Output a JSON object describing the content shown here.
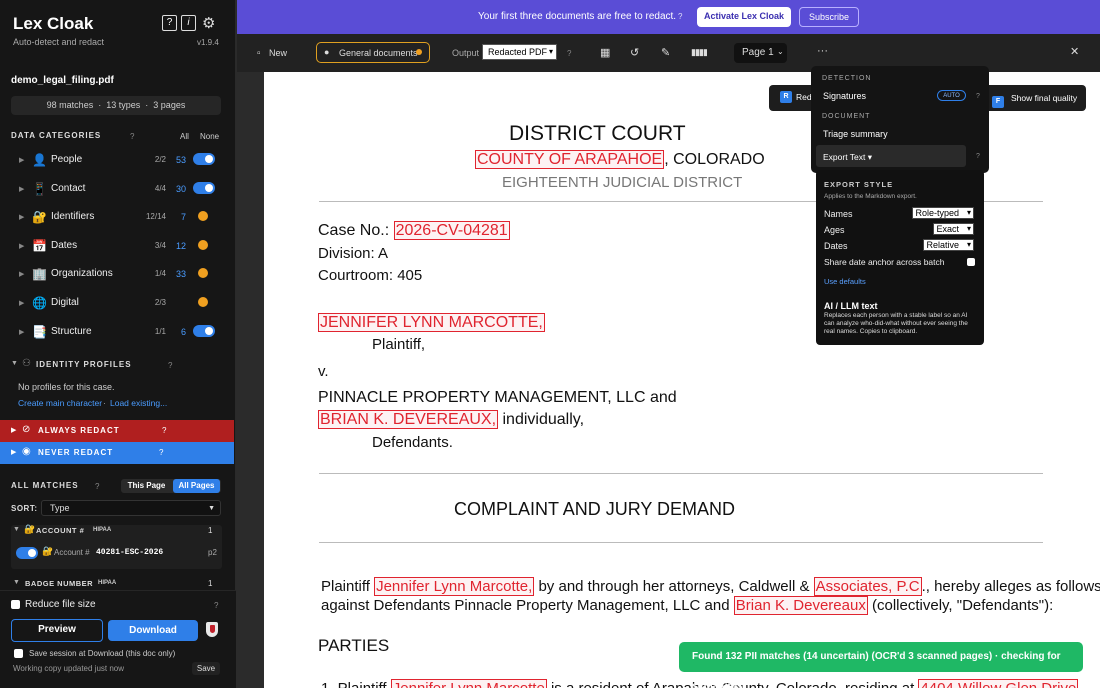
{
  "app": {
    "name": "Lex Cloak",
    "tagline": "Auto-detect and redact",
    "version": "v1.9.4",
    "help": "?",
    "info": "i",
    "settings_icon": "gear-icon"
  },
  "file": {
    "name": "demo_legal_filing.pdf",
    "matches": "98 matches",
    "types": "13 types",
    "pages": "3 pages",
    "sep": "·"
  },
  "categories": {
    "title": "DATA CATEGORIES",
    "help": "?",
    "all": "All",
    "none": "None",
    "items": [
      {
        "label": "People",
        "ratio": "2/2",
        "count": "53",
        "icon": "person-icon",
        "glyph": "👤",
        "state": "toggle"
      },
      {
        "label": "Contact",
        "ratio": "4/4",
        "count": "30",
        "icon": "phone-icon",
        "glyph": "📱",
        "state": "toggle"
      },
      {
        "label": "Identifiers",
        "ratio": "12/14",
        "count": "7",
        "icon": "id-icon",
        "glyph": "🔐",
        "state": "partial"
      },
      {
        "label": "Dates",
        "ratio": "3/4",
        "count": "12",
        "icon": "calendar-icon",
        "glyph": "📅",
        "state": "partial"
      },
      {
        "label": "Organizations",
        "ratio": "1/4",
        "count": "33",
        "icon": "building-icon",
        "glyph": "🏢",
        "state": "partial"
      },
      {
        "label": "Digital",
        "ratio": "2/3",
        "count": "",
        "icon": "globe-icon",
        "glyph": "🌐",
        "state": "partial"
      },
      {
        "label": "Structure",
        "ratio": "1/1",
        "count": "6",
        "icon": "structure-icon",
        "glyph": "📑",
        "state": "toggle"
      }
    ]
  },
  "profiles": {
    "title": "IDENTITY PROFILES",
    "help": "?",
    "empty": "No profiles for this case.",
    "create": "Create main character",
    "dot": "·",
    "load": "Load existing..."
  },
  "always": {
    "title": "ALWAYS REDACT",
    "help": "?"
  },
  "never": {
    "title": "NEVER REDACT",
    "help": "?"
  },
  "matches": {
    "title": "ALL MATCHES",
    "help": "?",
    "this_page": "This Page",
    "all_pages": "All Pages",
    "sort_label": "SORT:",
    "sort_value": "Type",
    "groups": [
      {
        "label": "ACCOUNT #",
        "badge": "HIPAA",
        "count": "1",
        "item_label": "Account #",
        "item_value": "40281-ESC-2026",
        "item_page": "p2"
      },
      {
        "label": "BADGE NUMBER",
        "badge": "HIPAA",
        "count": "1"
      }
    ]
  },
  "footer": {
    "reduce": "Reduce file size",
    "help": "?",
    "preview": "Preview",
    "download": "Download",
    "save_session": "Save session at Download (this doc only)",
    "working": "Working copy updated just now",
    "save": "Save"
  },
  "banner": {
    "message": "Your first three documents are free to redact.",
    "help": "?",
    "activate": "Activate Lex Cloak",
    "subscribe": "Subscribe"
  },
  "toolbar": {
    "new": "New",
    "doc_type": "General documents",
    "output_label": "Output",
    "output_value": "Redacted PDF",
    "help": "?",
    "page": "Page 1",
    "more": "···",
    "close": "✕"
  },
  "menu": {
    "detection": "DETECTION",
    "signatures": "Signatures",
    "auto": "AUTO",
    "help": "?",
    "document": "DOCUMENT",
    "triage": "Triage summary",
    "export": "Export Text ▾"
  },
  "export_style": {
    "title": "EXPORT STYLE",
    "subtitle": "Applies to the Markdown export.",
    "rows": [
      {
        "label": "Names",
        "value": "Role-typed"
      },
      {
        "label": "Ages",
        "value": "Exact"
      },
      {
        "label": "Dates",
        "value": "Relative"
      }
    ],
    "share": "Share date anchor across batch",
    "defaults": "Use defaults",
    "ai_title": "AI / LLM text",
    "ai_desc": "Replaces each person with a stable label so an AI can analyze who-did-what without ever seeing the real names. Copies to clipboard."
  },
  "chip": {
    "r": "R",
    "red": "Red",
    "f": "F",
    "show_final": "Show final quality"
  },
  "doc": {
    "court": "DISTRICT COURT",
    "county": "COUNTY OF ARAPAHOE",
    "state": ", COLORADO",
    "district": "EIGHTEENTH JUDICIAL DISTRICT",
    "case_label": "Case No.: ",
    "case_no": "2026-CV-04281",
    "division": "Division: A",
    "courtroom": "Courtroom: 405",
    "plaintiff_name": "JENNIFER LYNN MARCOTTE,",
    "plaintiff": "Plaintiff,",
    "v": "v.",
    "defendant1": "PINNACLE PROPERTY MANAGEMENT, LLC and",
    "defendant2_name": "BRIAN K. DEVEREAUX,",
    "individually": " individually,",
    "defendants": "Defendants.",
    "heading": "COMPLAINT AND JURY DEMAND",
    "p1_a": "Plaintiff ",
    "p1_name": "Jennifer Lynn Marcotte,",
    "p1_b": " by and through her attorneys, Caldwell & ",
    "p1_firm": "Associates, P.C",
    "p1_c": "., hereby alleges as follows",
    "p2_a": "against Defendants Pinnacle Property Management, LLC and ",
    "p2_name": "Brian K. Devereaux",
    "p2_b": " (collectively, \"Defendants\"):",
    "parties": "PARTIES",
    "l1_a": "1. Plaintiff ",
    "l1_name": "Jennifer Lynn Marcotte",
    "l1_b": " is a resident of Arapahoe County, Colorado, residing at ",
    "l1_addr": "4404 Willow Glen Drive"
  },
  "toast": "Found 132 PII matches (14 uncertain) (OCR'd 3 scanned pages) · checking for signatures",
  "colors": {
    "accent": "#2f7fe8",
    "banner": "#5a4dd6",
    "always": "#b01f1f",
    "never": "#2f7fe8",
    "toast": "#1fb865",
    "redact": "#e0242f"
  }
}
